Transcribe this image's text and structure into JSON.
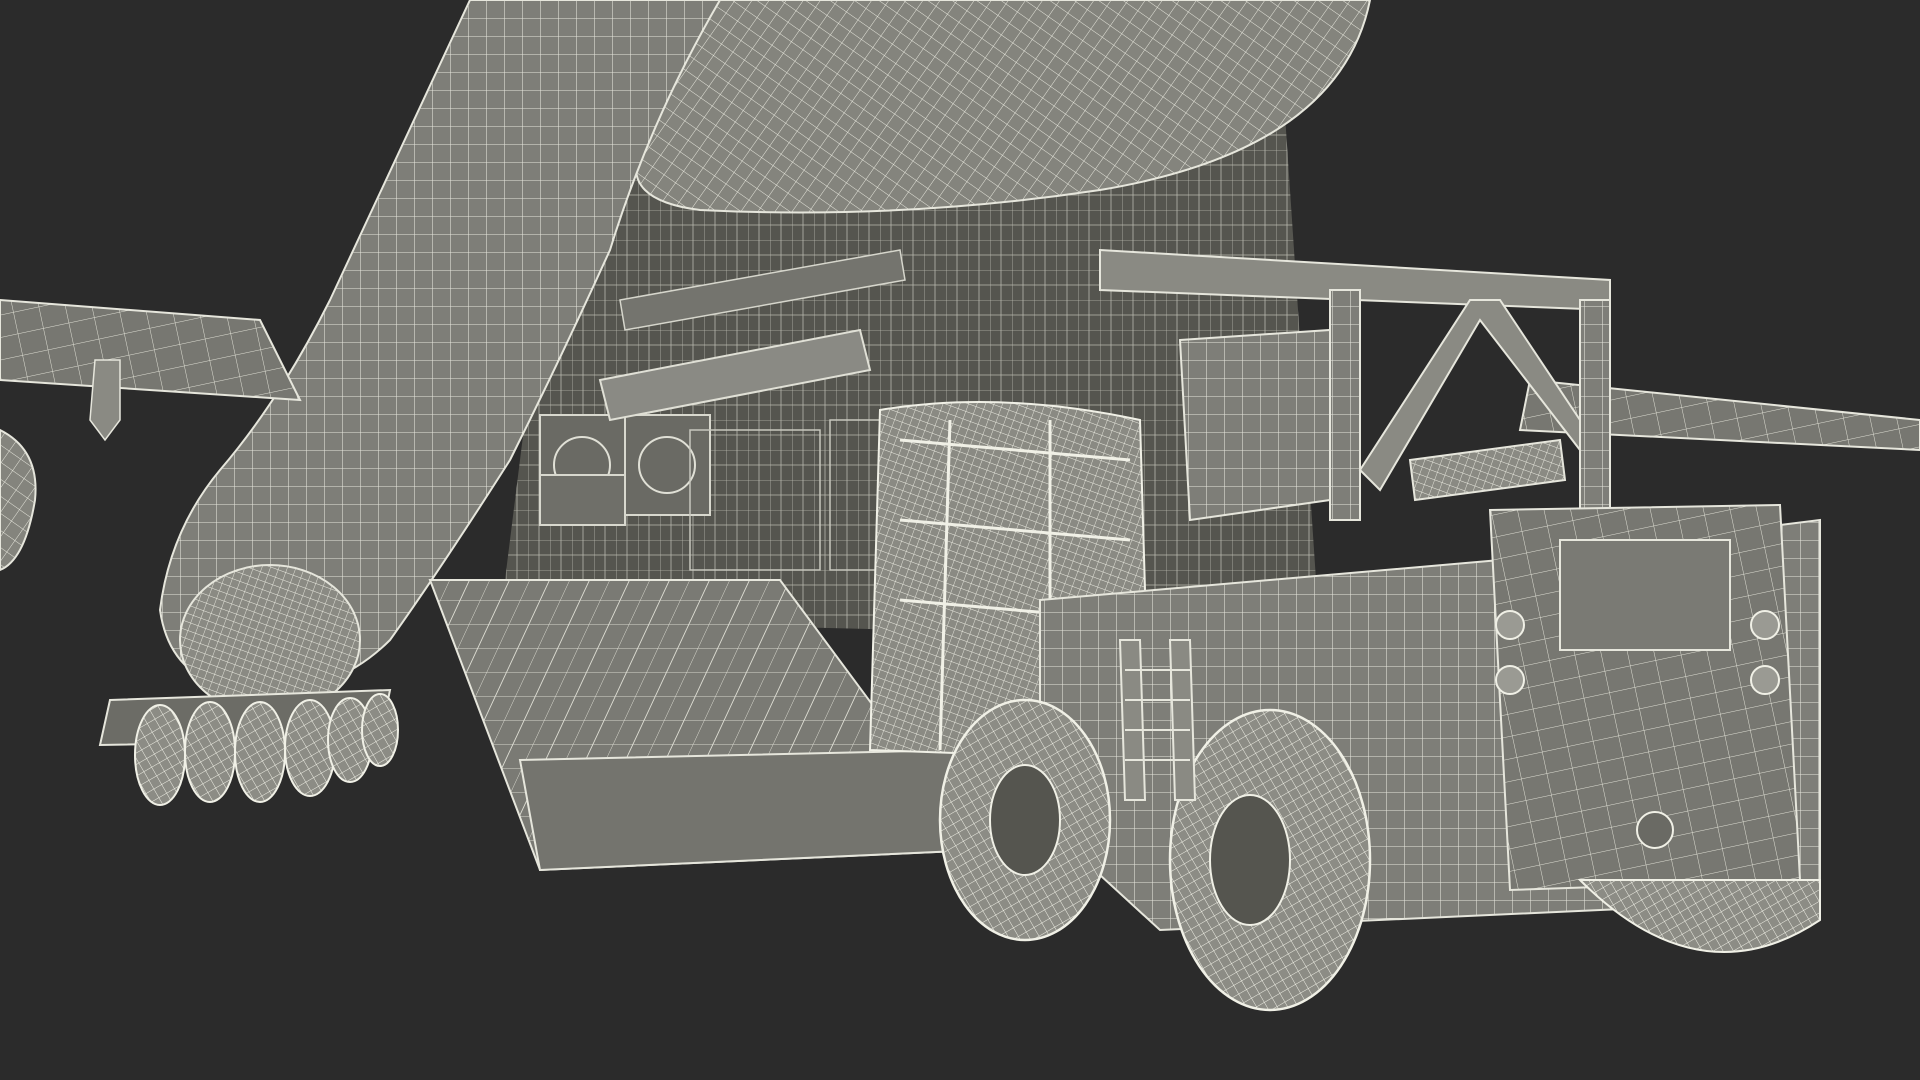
{
  "scene": {
    "colors": {
      "background": "#2b2b2b",
      "surface": "#7e7e78",
      "surface_dark": "#5e5e59",
      "surface_light": "#9a9a93",
      "wire": "#e6e6dc",
      "interior": "#4a4a46"
    }
  }
}
